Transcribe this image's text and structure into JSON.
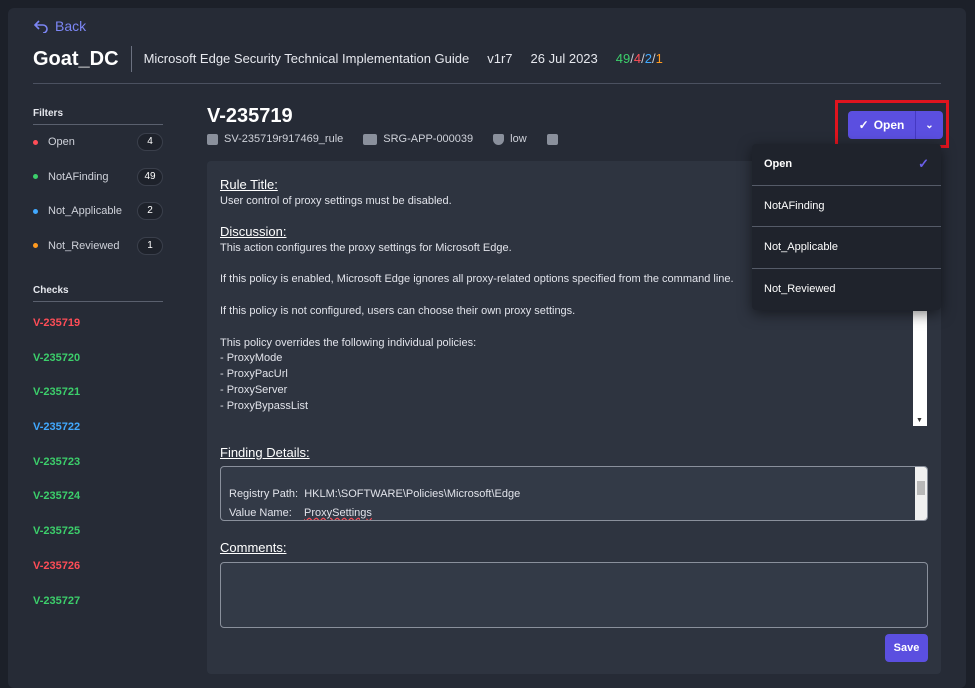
{
  "back_label": "Back",
  "header": {
    "title": "Goat_DC",
    "guide": "Microsoft Edge Security Technical Implementation Guide",
    "version": "v1r7",
    "date": "26 Jul 2023",
    "count_notafinding": "49",
    "count_open": "4",
    "count_not_applicable": "2",
    "count_not_reviewed": "1",
    "sep": "/"
  },
  "sidebar": {
    "filters_heading": "Filters",
    "filters": [
      {
        "label": "Open",
        "count": "4",
        "color": "#ff4d57"
      },
      {
        "label": "NotAFinding",
        "count": "49",
        "color": "#3ccf6b"
      },
      {
        "label": "Not_Applicable",
        "count": "2",
        "color": "#41a9ff"
      },
      {
        "label": "Not_Reviewed",
        "count": "1",
        "color": "#ff9a1f"
      }
    ],
    "checks_heading": "Checks",
    "checks": [
      {
        "label": "V-235719",
        "color": "#ff4d57"
      },
      {
        "label": "V-235720",
        "color": "#3ccf6b"
      },
      {
        "label": "V-235721",
        "color": "#3ccf6b"
      },
      {
        "label": "V-235722",
        "color": "#41a9ff"
      },
      {
        "label": "V-235723",
        "color": "#3ccf6b"
      },
      {
        "label": "V-235724",
        "color": "#3ccf6b"
      },
      {
        "label": "V-235725",
        "color": "#3ccf6b"
      },
      {
        "label": "V-235726",
        "color": "#ff4d57"
      },
      {
        "label": "V-235727",
        "color": "#3ccf6b"
      }
    ]
  },
  "main": {
    "vuln_id": "V-235719",
    "rule_id": "SV-235719r917469_rule",
    "srg": "SRG-APP-000039",
    "severity": "low",
    "status_label": "Open",
    "rule_title_label": "Rule Title:",
    "rule_title": "User control of proxy settings must be disabled.",
    "discussion_label": "Discussion:",
    "discussion": [
      "This action configures the proxy settings for Microsoft Edge.",
      "",
      "If this policy is enabled, Microsoft Edge ignores all proxy-related options specified from the command line.",
      "",
      "If this policy is not configured, users can choose their own proxy settings.",
      "",
      "This policy overrides the following individual policies:",
      "- ProxyMode",
      "- ProxyPacUrl",
      "- ProxyServer",
      "- ProxyBypassList"
    ],
    "finding_label": "Finding Details:",
    "finding_lines": [
      {
        "key": "Registry Path:",
        "value": "HKLM:\\SOFTWARE\\Policies\\Microsoft\\Edge"
      },
      {
        "key": "Value Name:",
        "value": "ProxySettings"
      }
    ],
    "comments_label": "Comments:",
    "comments_value": "",
    "save_label": "Save"
  },
  "dropdown": {
    "options": [
      "Open",
      "NotAFinding",
      "Not_Applicable",
      "Not_Reviewed"
    ],
    "selected": "Open"
  },
  "colors": {
    "accent": "#5b4fe0",
    "highlight_border": "#e0141e"
  }
}
